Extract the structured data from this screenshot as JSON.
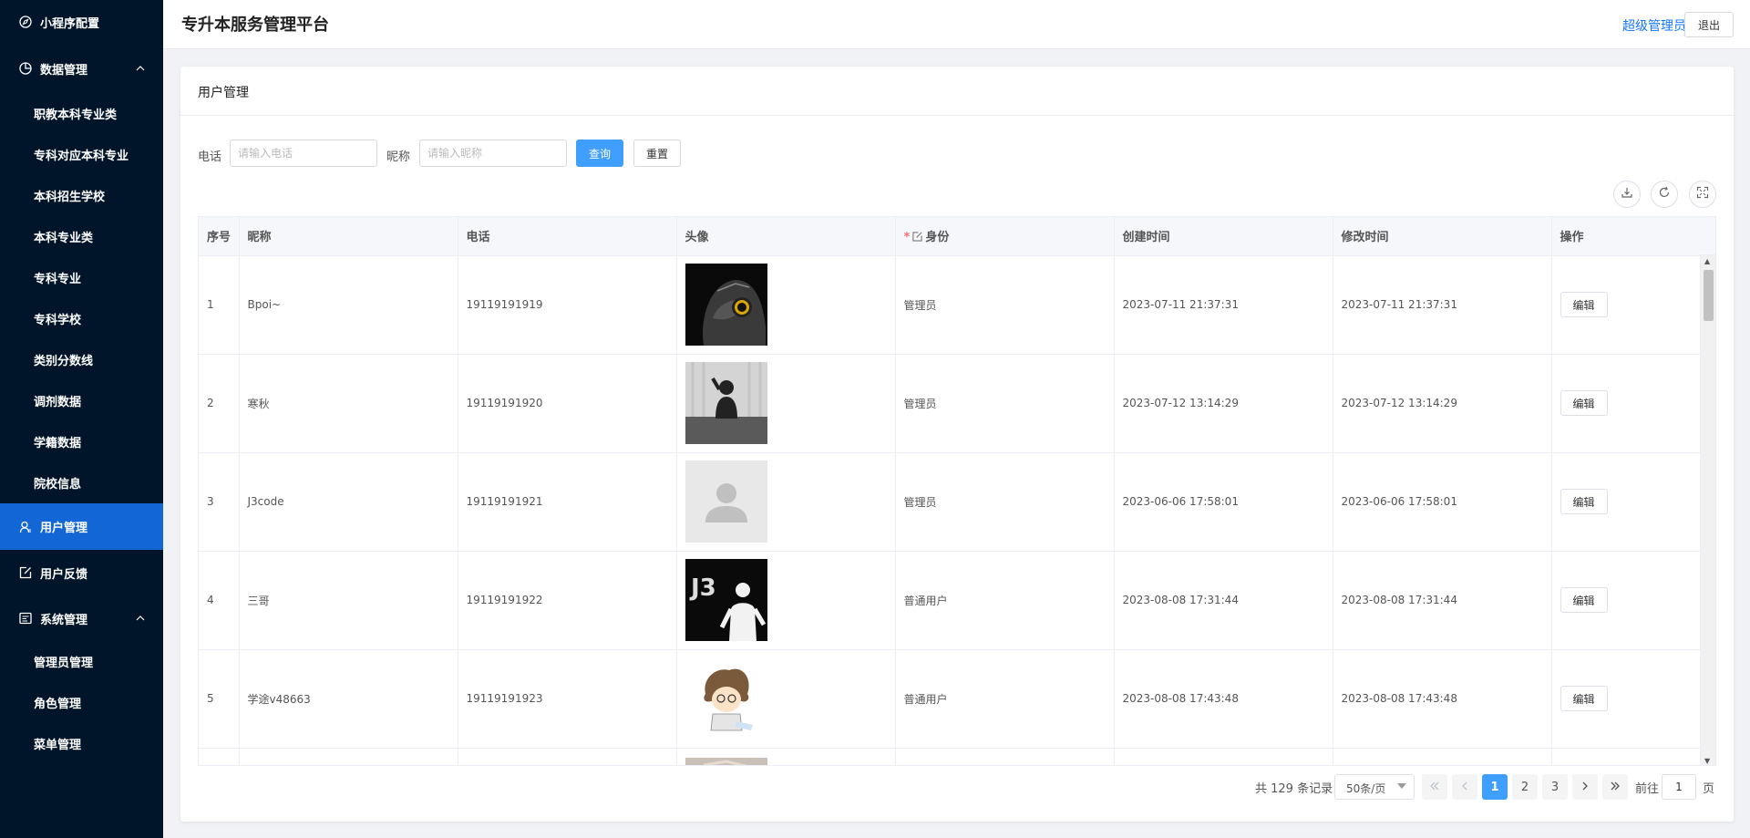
{
  "app": {
    "title": "专升本服务管理平台",
    "user": "超级管理员",
    "logout": "退出"
  },
  "sidebar": {
    "items": [
      {
        "label": "小程序配置",
        "icon": "compass-icon",
        "level": 1
      },
      {
        "label": "数据管理",
        "icon": "pie-chart-icon",
        "level": 1,
        "expanded": true
      },
      {
        "label": "职教本科专业类",
        "level": 2
      },
      {
        "label": "专科对应本科专业",
        "level": 2
      },
      {
        "label": "本科招生学校",
        "level": 2
      },
      {
        "label": "本科专业类",
        "level": 2
      },
      {
        "label": "专科专业",
        "level": 2
      },
      {
        "label": "专科学校",
        "level": 2
      },
      {
        "label": "类别分数线",
        "level": 2
      },
      {
        "label": "调剂数据",
        "level": 2
      },
      {
        "label": "学籍数据",
        "level": 2
      },
      {
        "label": "院校信息",
        "level": 2
      },
      {
        "label": "用户管理",
        "icon": "user-icon",
        "level": 1,
        "active": true
      },
      {
        "label": "用户反馈",
        "icon": "edit-icon",
        "level": 1
      },
      {
        "label": "系统管理",
        "icon": "system-icon",
        "level": 1,
        "expanded": true
      },
      {
        "label": "管理员管理",
        "level": 2
      },
      {
        "label": "角色管理",
        "level": 2
      },
      {
        "label": "菜单管理",
        "level": 2
      }
    ]
  },
  "page": {
    "title": "用户管理"
  },
  "search": {
    "phone_label": "电话",
    "phone_placeholder": "请输入电话",
    "nickname_label": "昵称",
    "nickname_placeholder": "请输入昵称",
    "query": "查询",
    "reset": "重置"
  },
  "toolbar": {
    "icons": [
      "download-icon",
      "refresh-icon",
      "fullscreen-icon"
    ]
  },
  "table": {
    "headers": {
      "index": "序号",
      "nickname": "昵称",
      "phone": "电话",
      "avatar": "头像",
      "role": "身份",
      "created": "创建时间",
      "modified": "修改时间",
      "action": "操作"
    },
    "rows": [
      {
        "index": "1",
        "nickname": "Bpoi~",
        "phone": "19119191919",
        "avatar": "owl",
        "role": "管理员",
        "created": "2023-07-11 21:37:31",
        "modified": "2023-07-11 21:37:31",
        "action": "编辑"
      },
      {
        "index": "2",
        "nickname": "寒秋",
        "phone": "19119191920",
        "avatar": "silhouette",
        "role": "管理员",
        "created": "2023-07-12 13:14:29",
        "modified": "2023-07-12 13:14:29",
        "action": "编辑"
      },
      {
        "index": "3",
        "nickname": "J3code",
        "phone": "19119191921",
        "avatar": "default",
        "role": "管理员",
        "created": "2023-06-06 17:58:01",
        "modified": "2023-06-06 17:58:01",
        "action": "编辑"
      },
      {
        "index": "4",
        "nickname": "三哥",
        "phone": "19119191922",
        "avatar": "j3",
        "role": "普通用户",
        "created": "2023-08-08 17:31:44",
        "modified": "2023-08-08 17:31:44",
        "action": "编辑"
      },
      {
        "index": "5",
        "nickname": "学途v48663",
        "phone": "19119191923",
        "avatar": "cartoon",
        "role": "普通用户",
        "created": "2023-08-08 17:43:48",
        "modified": "2023-08-08 17:43:48",
        "action": "编辑"
      }
    ]
  },
  "pagination": {
    "total": "共 129 条记录",
    "page_size": "50条/页",
    "pages": [
      "1",
      "2",
      "3"
    ],
    "current": "1",
    "goto_label": "前往",
    "goto_value": "1",
    "goto_suffix": "页"
  }
}
